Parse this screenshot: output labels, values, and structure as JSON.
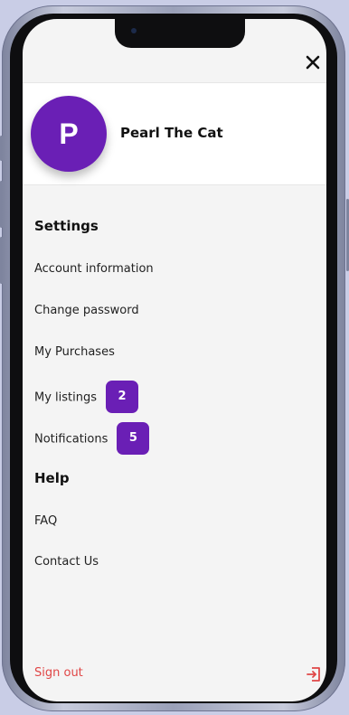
{
  "profile": {
    "avatar_initial": "P",
    "name": "Pearl The Cat"
  },
  "settings": {
    "title": "Settings",
    "items": [
      {
        "label": "Account information"
      },
      {
        "label": "Change password"
      },
      {
        "label": "My Purchases"
      },
      {
        "label": "My listings",
        "badge": "2"
      },
      {
        "label": "Notifications",
        "badge": "5"
      }
    ]
  },
  "help": {
    "title": "Help",
    "items": [
      {
        "label": "FAQ"
      },
      {
        "label": "Contact Us"
      }
    ]
  },
  "footer": {
    "signout_label": "Sign out"
  },
  "icons": {
    "close": "close-icon",
    "signout": "sign-out-icon"
  },
  "colors": {
    "accent": "#6a1fb5",
    "signout": "#e04646",
    "background": "#f4f4f4",
    "frame": "#c9cde6"
  }
}
